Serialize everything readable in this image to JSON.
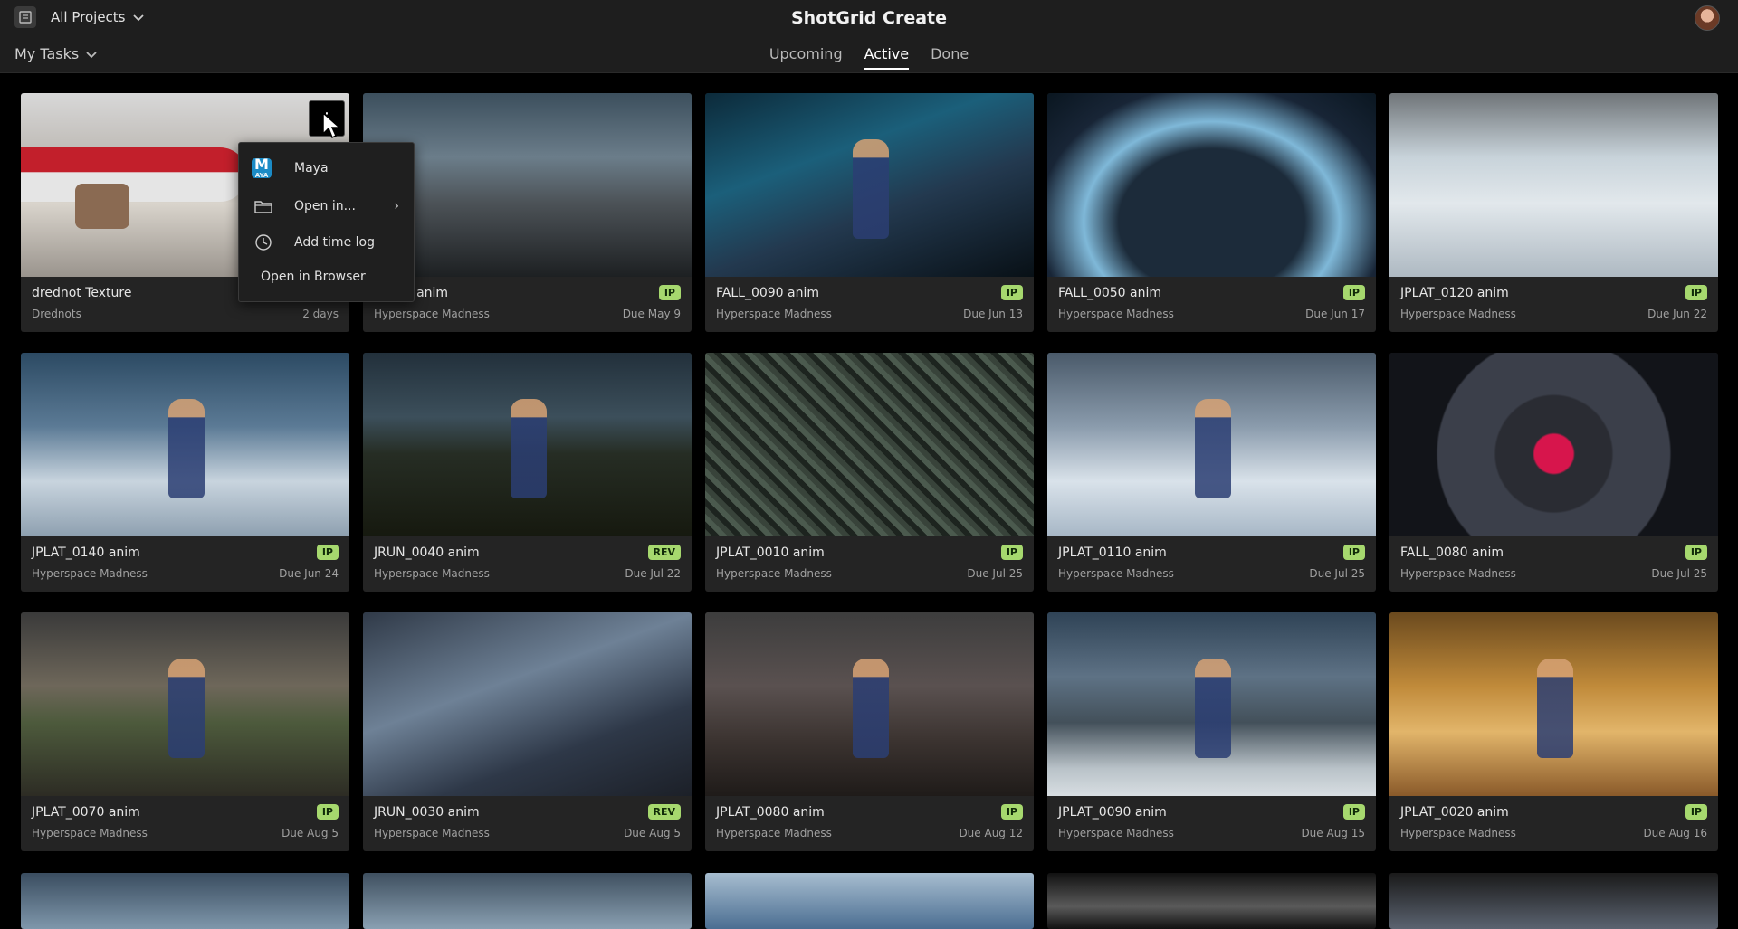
{
  "header": {
    "project_selector": "All Projects",
    "app_title": "ShotGrid Create",
    "task_filter": "My Tasks",
    "tabs": [
      {
        "label": "Upcoming"
      },
      {
        "label": "Active"
      },
      {
        "label": "Done"
      }
    ]
  },
  "context_menu": {
    "items": [
      {
        "label": "Maya",
        "icon": "maya-icon",
        "icon_text": "M",
        "icon_subtext": "AYA"
      },
      {
        "label": "Open in...",
        "icon": "folder-icon"
      },
      {
        "label": "Add time log",
        "icon": "clock-icon"
      },
      {
        "label": "Open in Browser"
      }
    ]
  },
  "kebab": {
    "label": "⋮"
  },
  "cards": [
    {
      "title": "drednot Texture",
      "project": "Drednots",
      "due": "2 days",
      "status": ""
    },
    {
      "title": "_0060 anim",
      "project": "Hyperspace Madness",
      "due": "Due May 9",
      "status": "IP"
    },
    {
      "title": "FALL_0090 anim",
      "project": "Hyperspace Madness",
      "due": "Due Jun 13",
      "status": "IP"
    },
    {
      "title": "FALL_0050 anim",
      "project": "Hyperspace Madness",
      "due": "Due Jun 17",
      "status": "IP"
    },
    {
      "title": "JPLAT_0120 anim",
      "project": "Hyperspace Madness",
      "due": "Due Jun 22",
      "status": "IP"
    },
    {
      "title": "JPLAT_0140 anim",
      "project": "Hyperspace Madness",
      "due": "Due Jun 24",
      "status": "IP"
    },
    {
      "title": "JRUN_0040 anim",
      "project": "Hyperspace Madness",
      "due": "Due Jul 22",
      "status": "REV"
    },
    {
      "title": "JPLAT_0010 anim",
      "project": "Hyperspace Madness",
      "due": "Due Jul 25",
      "status": "IP"
    },
    {
      "title": "JPLAT_0110 anim",
      "project": "Hyperspace Madness",
      "due": "Due Jul 25",
      "status": "IP"
    },
    {
      "title": "FALL_0080 anim",
      "project": "Hyperspace Madness",
      "due": "Due Jul 25",
      "status": "IP"
    },
    {
      "title": "JPLAT_0070 anim",
      "project": "Hyperspace Madness",
      "due": "Due Aug 5",
      "status": "IP"
    },
    {
      "title": "JRUN_0030 anim",
      "project": "Hyperspace Madness",
      "due": "Due Aug 5",
      "status": "REV"
    },
    {
      "title": "JPLAT_0080 anim",
      "project": "Hyperspace Madness",
      "due": "Due Aug 12",
      "status": "IP"
    },
    {
      "title": "JPLAT_0090 anim",
      "project": "Hyperspace Madness",
      "due": "Due Aug 15",
      "status": "IP"
    },
    {
      "title": "JPLAT_0020 anim",
      "project": "Hyperspace Madness",
      "due": "Due Aug 16",
      "status": "IP"
    }
  ],
  "colors": {
    "status_badge": "#a6d86e",
    "background": "#000000",
    "card": "#242424",
    "header": "#1e1e1e"
  }
}
